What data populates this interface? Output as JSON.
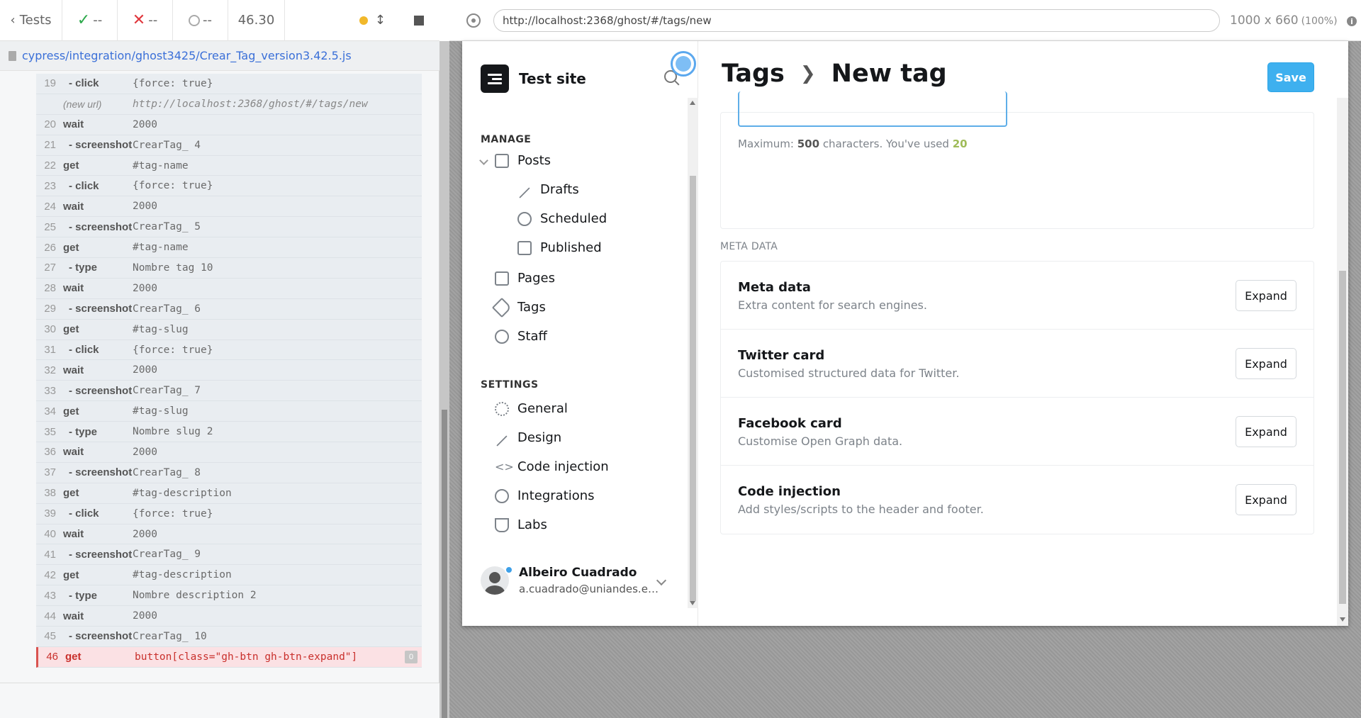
{
  "reporter": {
    "tests_label": "Tests",
    "passed": "--",
    "failed": "--",
    "pending": "--",
    "duration": "46.30",
    "spec_path": "cypress/integration/ghost3425/Crear_Tag_version3.42.5.js",
    "commands": [
      {
        "num": "19",
        "name": "- click",
        "arg": "{force: true}",
        "kind": "child"
      },
      {
        "num": "",
        "name": "(new url)",
        "arg": "http://localhost:2368/ghost/#/tags/new",
        "kind": "url"
      },
      {
        "num": "20",
        "name": "wait",
        "arg": "2000",
        "kind": "parent"
      },
      {
        "num": "21",
        "name": "- screenshot",
        "arg": "CrearTag_ 4",
        "kind": "child"
      },
      {
        "num": "22",
        "name": "get",
        "arg": "#tag-name",
        "kind": "parent"
      },
      {
        "num": "23",
        "name": "- click",
        "arg": "{force: true}",
        "kind": "child"
      },
      {
        "num": "24",
        "name": "wait",
        "arg": "2000",
        "kind": "parent"
      },
      {
        "num": "25",
        "name": "- screenshot",
        "arg": "CrearTag_ 5",
        "kind": "child"
      },
      {
        "num": "26",
        "name": "get",
        "arg": "#tag-name",
        "kind": "parent"
      },
      {
        "num": "27",
        "name": "- type",
        "arg": "Nombre tag 10",
        "kind": "child"
      },
      {
        "num": "28",
        "name": "wait",
        "arg": "2000",
        "kind": "parent"
      },
      {
        "num": "29",
        "name": "- screenshot",
        "arg": "CrearTag_ 6",
        "kind": "child"
      },
      {
        "num": "30",
        "name": "get",
        "arg": "#tag-slug",
        "kind": "parent"
      },
      {
        "num": "31",
        "name": "- click",
        "arg": "{force: true}",
        "kind": "child"
      },
      {
        "num": "32",
        "name": "wait",
        "arg": "2000",
        "kind": "parent"
      },
      {
        "num": "33",
        "name": "- screenshot",
        "arg": "CrearTag_ 7",
        "kind": "child"
      },
      {
        "num": "34",
        "name": "get",
        "arg": "#tag-slug",
        "kind": "parent"
      },
      {
        "num": "35",
        "name": "- type",
        "arg": "Nombre slug 2",
        "kind": "child"
      },
      {
        "num": "36",
        "name": "wait",
        "arg": "2000",
        "kind": "parent"
      },
      {
        "num": "37",
        "name": "- screenshot",
        "arg": "CrearTag_ 8",
        "kind": "child"
      },
      {
        "num": "38",
        "name": "get",
        "arg": "#tag-description",
        "kind": "parent"
      },
      {
        "num": "39",
        "name": "- click",
        "arg": "{force: true}",
        "kind": "child"
      },
      {
        "num": "40",
        "name": "wait",
        "arg": "2000",
        "kind": "parent"
      },
      {
        "num": "41",
        "name": "- screenshot",
        "arg": "CrearTag_ 9",
        "kind": "child"
      },
      {
        "num": "42",
        "name": "get",
        "arg": "#tag-description",
        "kind": "parent"
      },
      {
        "num": "43",
        "name": "- type",
        "arg": "Nombre description 2",
        "kind": "child"
      },
      {
        "num": "44",
        "name": "wait",
        "arg": "2000",
        "kind": "parent"
      },
      {
        "num": "45",
        "name": "- screenshot",
        "arg": "CrearTag_ 10",
        "kind": "child"
      },
      {
        "num": "46",
        "name": "get",
        "arg": "button[class=\"gh-btn gh-btn-expand\"]",
        "kind": "failed",
        "count": "0"
      }
    ]
  },
  "browser": {
    "url": "http://localhost:2368/ghost/#/tags/new",
    "viewport": "1000 x 660",
    "zoom": "(100%)"
  },
  "ghost": {
    "site_title": "Test site",
    "manage_label": "MANAGE",
    "settings_label": "SETTINGS",
    "nav": {
      "posts": "Posts",
      "drafts": "Drafts",
      "scheduled": "Scheduled",
      "published": "Published",
      "pages": "Pages",
      "tags": "Tags",
      "staff": "Staff",
      "general": "General",
      "design": "Design",
      "code_injection": "Code injection",
      "integrations": "Integrations",
      "labs": "Labs"
    },
    "user": {
      "name": "Albeiro Cuadrado",
      "email": "a.cuadrado@uniandes.edu.co"
    },
    "breadcrumb_parent": "Tags",
    "breadcrumb_current": "New tag",
    "save_label": "Save",
    "desc_hint_prefix": "Maximum: ",
    "desc_hint_max": "500",
    "desc_hint_mid": " characters. You've used ",
    "desc_hint_used": "20",
    "meta_section_label": "META DATA",
    "meta_rows": [
      {
        "title": "Meta data",
        "desc": "Extra content for search engines.",
        "button": "Expand"
      },
      {
        "title": "Twitter card",
        "desc": "Customised structured data for Twitter.",
        "button": "Expand"
      },
      {
        "title": "Facebook card",
        "desc": "Customise Open Graph data.",
        "button": "Expand"
      },
      {
        "title": "Code injection",
        "desc": "Add styles/scripts to the header and footer.",
        "button": "Expand"
      }
    ]
  }
}
